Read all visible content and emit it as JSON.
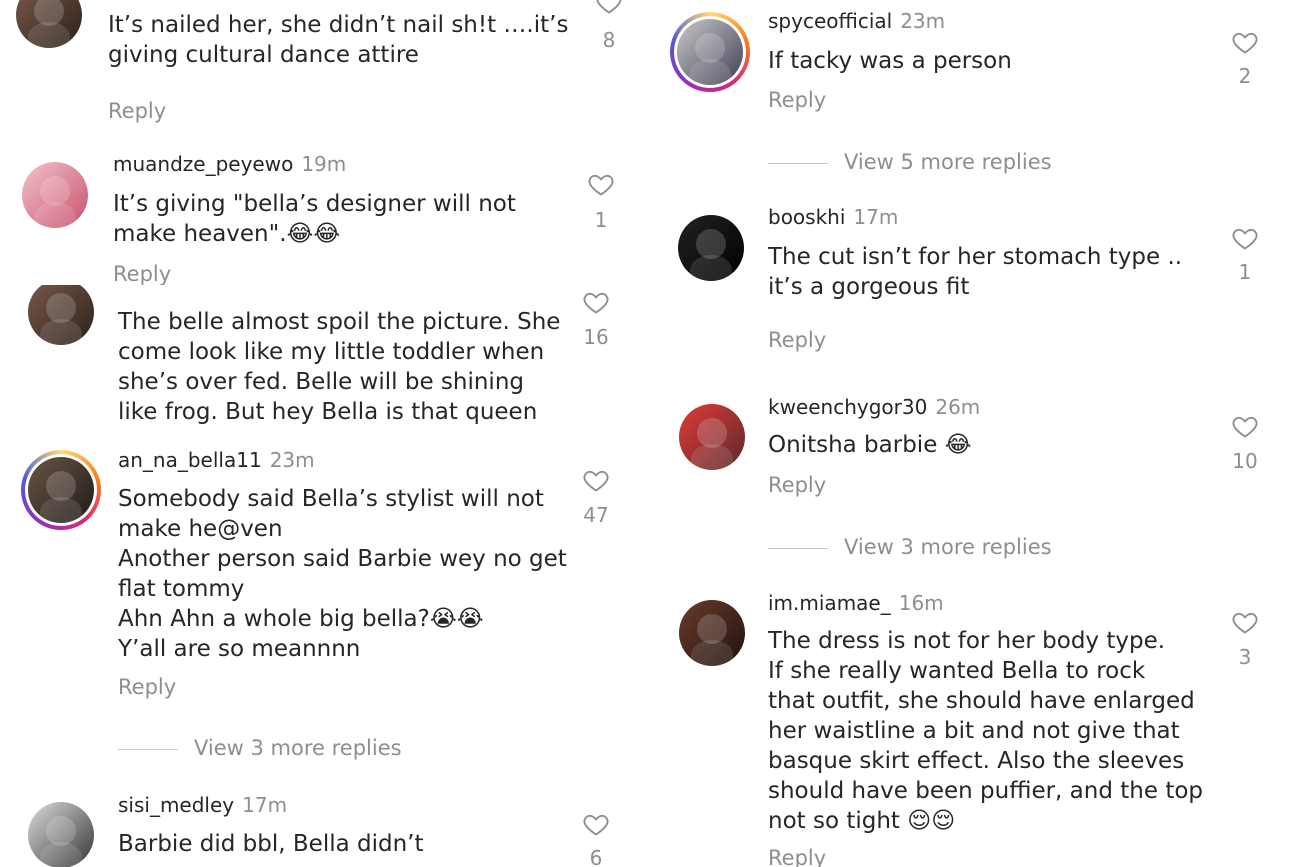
{
  "left": {
    "c1": {
      "text": "It’s nailed her, she didn’t nail sh!t ….it’s\ngiving cultural dance attire",
      "likes": "8",
      "reply": "Reply"
    },
    "c2": {
      "user": "muandze_peyewo",
      "time": "19m",
      "text": "It’s giving \"bella’s designer will not\nmake heaven\".😂😂",
      "likes": "1",
      "reply": "Reply"
    },
    "c3": {
      "text": "The belle almost spoil the picture. She\ncome look like my little toddler when\nshe’s over fed. Belle will be shining\nlike frog. But hey Bella is that queen",
      "likes": "16"
    },
    "c4": {
      "user": "an_na_bella11",
      "time": "23m",
      "text": "Somebody said Bella’s stylist will not\nmake he@ven\nAnother person said Barbie wey no get\nflat tommy\nAhn Ahn a whole big bella?😭😭\nY’all are so meannnn",
      "likes": "47",
      "reply": "Reply"
    },
    "more1": "View 3 more replies",
    "c5": {
      "user": "sisi_medley",
      "time": "17m",
      "text": "Barbie did bbl, Bella didn’t",
      "likes": "6"
    }
  },
  "right": {
    "c1": {
      "user": "spyceofficial",
      "time": "23m",
      "text": "If tacky was a person",
      "likes": "2",
      "reply": "Reply"
    },
    "more1": "View 5 more replies",
    "c2": {
      "user": "booskhi",
      "time": "17m",
      "text": "The cut isn’t for her stomach type ..\nit’s a gorgeous fit",
      "likes": "1",
      "reply": "Reply"
    },
    "c3": {
      "user": "kweenchygor30",
      "time": "26m",
      "text": "Onitsha barbie 😂",
      "likes": "10",
      "reply": "Reply"
    },
    "more2": "View 3 more replies",
    "c4": {
      "user": "im.miamae_",
      "time": "16m",
      "text": "The dress is not for her body type.\nIf she really wanted Bella to rock\nthat outfit, she should have enlarged\nher waistline a bit and not give that\nbasque skirt effect. Also the sleeves\nshould have been puffier, and the top\nnot so tight 😌😌",
      "likes": "3",
      "reply": "Reply"
    }
  },
  "icons": {
    "heart": "heart-outline-icon"
  },
  "colors": {
    "text": "#262626",
    "muted": "#8e8e8e",
    "story_ring": "instagram-gradient"
  }
}
